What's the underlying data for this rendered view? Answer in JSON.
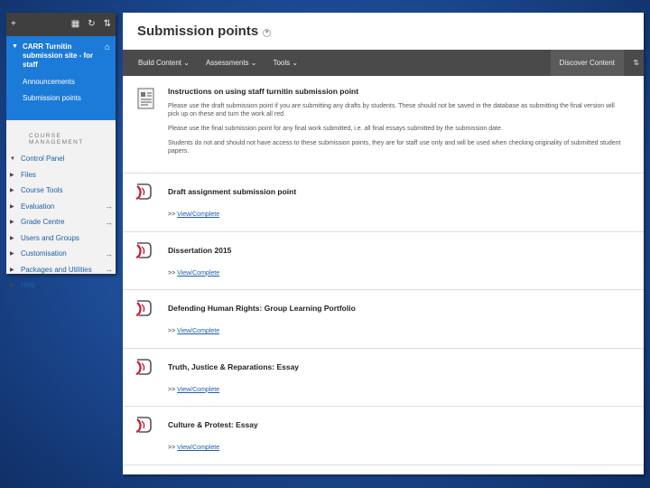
{
  "sidebar": {
    "toolbar_icons": [
      "plus-icon",
      "folder-icon",
      "refresh-icon",
      "sort-icon"
    ],
    "course": {
      "title": "CARR Turnitin submission site - for staff",
      "links": [
        "Announcements",
        "Submission points"
      ]
    },
    "section_label": "COURSE MANAGEMENT",
    "nav": [
      {
        "label": "Control Panel",
        "expanded": true,
        "arrow": false
      },
      {
        "label": "Files",
        "expanded": false,
        "arrow": false
      },
      {
        "label": "Course Tools",
        "expanded": false,
        "arrow": false
      },
      {
        "label": "Evaluation",
        "expanded": false,
        "arrow": true
      },
      {
        "label": "Grade Centre",
        "expanded": false,
        "arrow": true
      },
      {
        "label": "Users and Groups",
        "expanded": false,
        "arrow": false
      },
      {
        "label": "Customisation",
        "expanded": false,
        "arrow": true
      },
      {
        "label": "Packages and Utilities",
        "expanded": false,
        "arrow": true
      },
      {
        "label": "Help",
        "expanded": false,
        "arrow": false
      }
    ]
  },
  "page": {
    "title": "Submission points"
  },
  "action_bar": {
    "items": [
      "Build Content",
      "Assessments",
      "Tools"
    ],
    "right": "Discover Content"
  },
  "instructions": {
    "title": "Instructions on using staff turnitin submission point",
    "paragraphs": [
      "Please use the draft submission point if you are submitting any drafts by students. These should not be saved in the database as submitting the final version will pick up on these and turn the work all red.",
      "Please use the final submission point for any final work submitted, i.e. all final essays submitted by the submission date.",
      "Students do not and should not have access to these submission points, they are for staff use only and will be used when checking originality of submitted student papers."
    ]
  },
  "assignments": [
    {
      "title": "Draft assignment submission point",
      "link_prefix": ">>",
      "link": "View/Complete"
    },
    {
      "title": "Dissertation 2015",
      "link_prefix": ">>",
      "link": "View/Complete"
    },
    {
      "title": "Defending Human Rights: Group Learning Portfolio",
      "link_prefix": ">>",
      "link": "View/Complete"
    },
    {
      "title": "Truth, Justice & Reparations: Essay",
      "link_prefix": ">>",
      "link": "View/Complete"
    },
    {
      "title": "Culture & Protest: Essay",
      "link_prefix": ">>",
      "link": "View/Complete"
    }
  ],
  "colors": {
    "accent": "#1c7ad8",
    "link": "#1d5fa8",
    "turnitin_red": "#c8202f"
  }
}
